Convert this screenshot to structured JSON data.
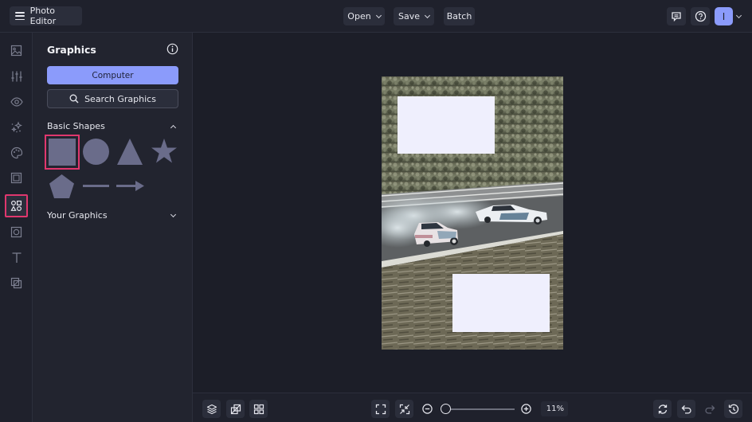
{
  "header": {
    "app_title": "Photo Editor",
    "menu": [
      {
        "label": "Open",
        "has_dropdown": true
      },
      {
        "label": "Save",
        "has_dropdown": true
      },
      {
        "label": "Batch",
        "has_dropdown": false
      }
    ],
    "right_icons": [
      "feedback-icon",
      "help-icon"
    ],
    "avatar_initial": "I"
  },
  "rail": {
    "items": [
      {
        "name": "image-icon",
        "active": false
      },
      {
        "name": "adjustments-icon",
        "active": false
      },
      {
        "name": "eye-icon",
        "active": false
      },
      {
        "name": "sparkles-icon",
        "active": false
      },
      {
        "name": "palette-icon",
        "active": false
      },
      {
        "name": "frame-icon",
        "active": false
      },
      {
        "name": "graphics-icon",
        "active": true
      },
      {
        "name": "texture-icon",
        "active": false
      },
      {
        "name": "text-icon",
        "active": false
      },
      {
        "name": "overlay-icon",
        "active": false
      }
    ]
  },
  "panel": {
    "title": "Graphics",
    "computer_label": "Computer",
    "search_label": "Search Graphics",
    "sections": [
      {
        "label": "Basic Shapes",
        "expanded": true
      },
      {
        "label": "Your Graphics",
        "expanded": false
      }
    ],
    "shapes": [
      "square",
      "circle",
      "triangle",
      "star",
      "pentagon",
      "line",
      "arrow"
    ],
    "selected_shape": "square"
  },
  "bottombar": {
    "zoom_value": "11%",
    "zoom_level_fraction": 0.0
  },
  "colors": {
    "accent": "#8b9bfb",
    "highlight": "#e0376e",
    "shape_fill": "#6a6c8a",
    "background": "#1f212c"
  }
}
